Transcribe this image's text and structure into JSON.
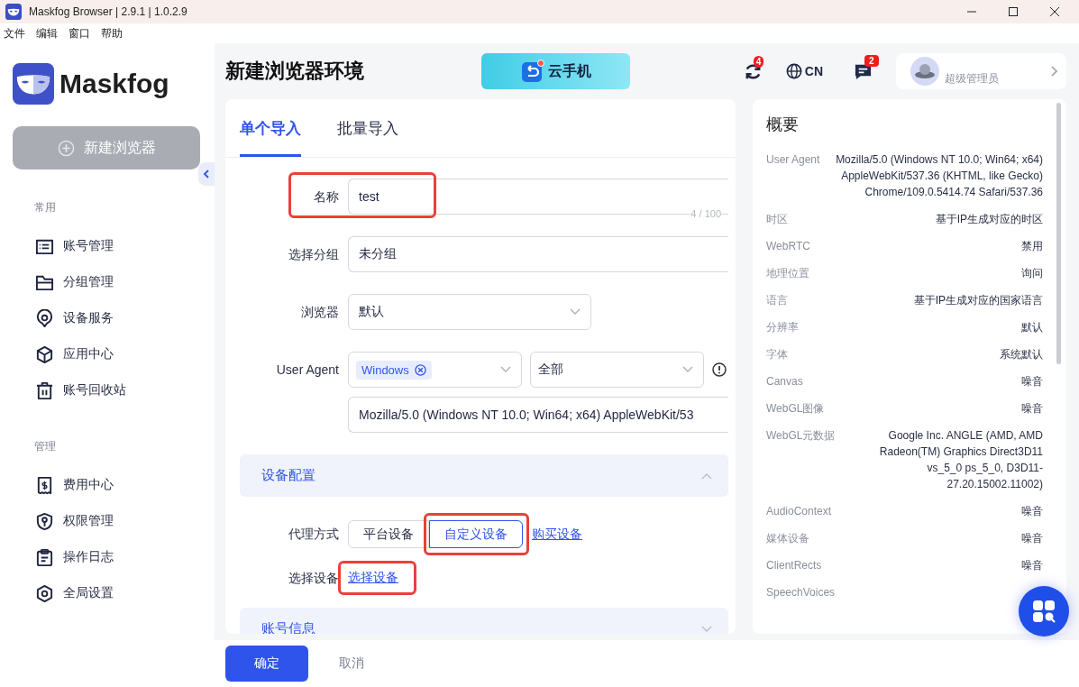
{
  "window": {
    "title": "Maskfog Browser | 2.9.1 | 1.0.2.9"
  },
  "menu_bar": [
    "文件",
    "编辑",
    "窗口",
    "帮助"
  ],
  "sidebar": {
    "logo_text": "Maskfog",
    "new_button": "新建浏览器",
    "sections": [
      {
        "title": "常用",
        "items": [
          {
            "label": "账号管理"
          },
          {
            "label": "分组管理"
          },
          {
            "label": "设备服务"
          },
          {
            "label": "应用中心"
          },
          {
            "label": "账号回收站"
          }
        ]
      },
      {
        "title": "管理",
        "items": [
          {
            "label": "费用中心"
          },
          {
            "label": "权限管理"
          },
          {
            "label": "操作日志"
          },
          {
            "label": "全局设置"
          }
        ]
      }
    ]
  },
  "header": {
    "title": "新建浏览器环境",
    "promo": "云手机",
    "sync_badge": "4",
    "language": "CN",
    "message_badge": "2",
    "user_role": "超级管理员"
  },
  "form": {
    "tabs": [
      {
        "label": "单个导入",
        "selected": true
      },
      {
        "label": "批量导入",
        "selected": false
      }
    ],
    "name": {
      "label": "名称",
      "value": "test",
      "counter": "4 / 100",
      "highlighted": true
    },
    "group": {
      "label": "选择分组",
      "value": "未分组"
    },
    "browser": {
      "label": "浏览器",
      "value": "默认"
    },
    "user_agent": {
      "label": "User Agent",
      "tag": "Windows",
      "filter": "全部",
      "value": "Mozilla/5.0 (Windows NT 10.0; Win64; x64) AppleWebKit/53"
    },
    "sections": [
      {
        "title": "设备配置",
        "expanded": true,
        "proxy": {
          "label": "代理方式",
          "options": [
            {
              "label": "平台设备",
              "selected": false,
              "highlighted": false
            },
            {
              "label": "自定义设备",
              "selected": true,
              "highlighted": true
            }
          ],
          "link": "购买设备"
        },
        "device": {
          "label": "选择设备",
          "link": "选择设备",
          "highlighted": true
        }
      },
      {
        "title": "账号信息",
        "expanded": false
      }
    ]
  },
  "overview": {
    "title": "概要",
    "rows": [
      {
        "label": "User Agent",
        "value": "Mozilla/5.0 (Windows NT 10.0; Win64; x64) AppleWebKit/537.36 (KHTML, like Gecko) Chrome/109.0.5414.74 Safari/537.36"
      },
      {
        "label": "时区",
        "value": "基于IP生成对应的时区"
      },
      {
        "label": "WebRTC",
        "value": "禁用"
      },
      {
        "label": "地理位置",
        "value": "询问"
      },
      {
        "label": "语言",
        "value": "基于IP生成对应的国家语言"
      },
      {
        "label": "分辨率",
        "value": "默认"
      },
      {
        "label": "字体",
        "value": "系统默认"
      },
      {
        "label": "Canvas",
        "value": "噪音"
      },
      {
        "label": "WebGL图像",
        "value": "噪音"
      },
      {
        "label": "WebGL元数据",
        "value": "Google Inc. ANGLE (AMD, AMD Radeon(TM) Graphics Direct3D11 vs_5_0 ps_5_0, D3D11-27.20.15002.11002)"
      },
      {
        "label": "AudioContext",
        "value": "噪音"
      },
      {
        "label": "媒体设备",
        "value": "噪音"
      },
      {
        "label": "ClientRects",
        "value": "噪音"
      },
      {
        "label": "SpeechVoices"
      }
    ]
  },
  "footer": {
    "confirm": "确定",
    "cancel": "取消"
  }
}
